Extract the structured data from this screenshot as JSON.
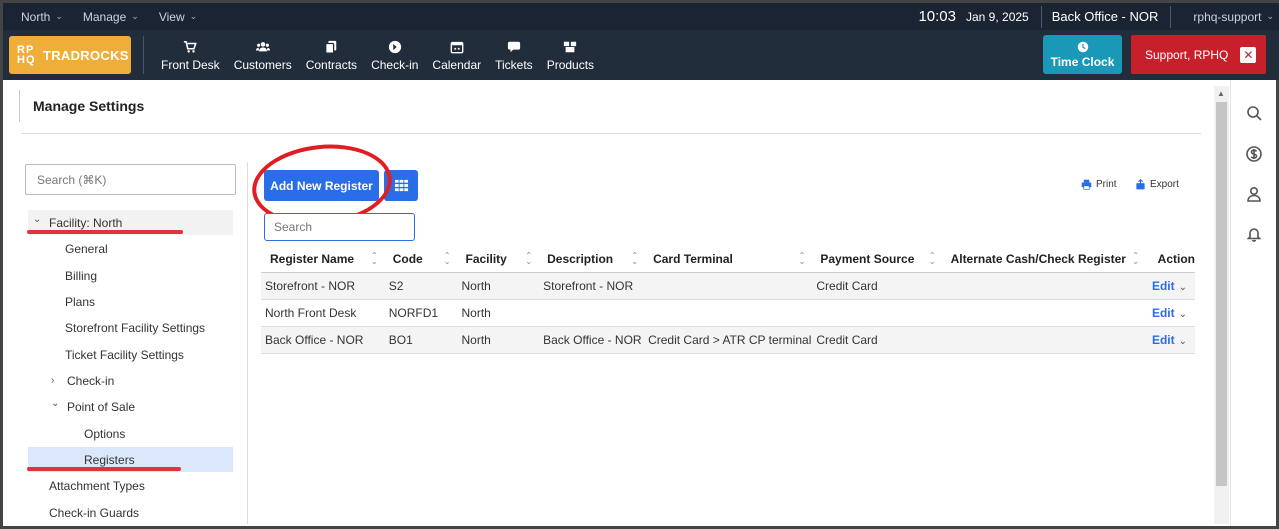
{
  "topbar": {
    "menus": [
      {
        "label": "North"
      },
      {
        "label": "Manage"
      },
      {
        "label": "View"
      }
    ],
    "time": "10:03",
    "date": "Jan 9, 2025",
    "register": "Back Office - NOR",
    "user": "rphq-support"
  },
  "nav": {
    "logo_mark_line1": "RP",
    "logo_mark_line2": "HQ",
    "logo_name": "TRADROCKS",
    "items": [
      {
        "label": "Front Desk",
        "icon": "cart-icon"
      },
      {
        "label": "Customers",
        "icon": "users-icon"
      },
      {
        "label": "Contracts",
        "icon": "contracts-icon"
      },
      {
        "label": "Check-in",
        "icon": "check-in-icon"
      },
      {
        "label": "Calendar",
        "icon": "calendar-icon"
      },
      {
        "label": "Tickets",
        "icon": "chat-icon"
      },
      {
        "label": "Products",
        "icon": "boxes-icon"
      }
    ],
    "time_clock": "Time Clock",
    "support": "Support, RPHQ"
  },
  "page": {
    "title": "Manage Settings"
  },
  "sidebar": {
    "search_placeholder": "Search (⌘K)",
    "items": [
      {
        "label": "Facility: North",
        "caret": "⌄",
        "level": 0
      },
      {
        "label": "General",
        "caret": "",
        "level": 1
      },
      {
        "label": "Billing",
        "caret": "",
        "level": 1
      },
      {
        "label": "Plans",
        "caret": "",
        "level": 1
      },
      {
        "label": "Storefront Facility Settings",
        "caret": "",
        "level": 1
      },
      {
        "label": "Ticket Facility Settings",
        "caret": "",
        "level": 1
      },
      {
        "label": "Check-in",
        "caret": "›",
        "level": 1
      },
      {
        "label": "Point of Sale",
        "caret": "⌄",
        "level": 1
      },
      {
        "label": "Options",
        "caret": "",
        "level": 2
      },
      {
        "label": "Registers",
        "caret": "",
        "level": 2,
        "selected": true
      },
      {
        "label": "Attachment Types",
        "caret": "",
        "level": 0
      },
      {
        "label": "Check-in Guards",
        "caret": "",
        "level": 0
      }
    ]
  },
  "main": {
    "add_button": "Add New Register",
    "search_placeholder": "Search",
    "print_label": "Print",
    "export_label": "Export",
    "columns": [
      "Register Name",
      "Code",
      "Facility",
      "Description",
      "Card Terminal",
      "Payment Source",
      "Alternate Cash/Check Register",
      "Action"
    ],
    "rows": [
      {
        "name": "Storefront - NOR",
        "code": "S2",
        "facility": "North",
        "description": "Storefront - NOR",
        "card_terminal": "",
        "payment_source": "Credit Card",
        "alternate": "",
        "action": "Edit"
      },
      {
        "name": "North Front Desk",
        "code": "NORFD1",
        "facility": "North",
        "description": "",
        "card_terminal": "",
        "payment_source": "",
        "alternate": "",
        "action": "Edit"
      },
      {
        "name": "Back Office - NOR",
        "code": "BO1",
        "facility": "North",
        "description": "Back Office - NOR",
        "card_terminal": "Credit Card > ATR CP terminal",
        "payment_source": "Credit Card",
        "alternate": "",
        "action": "Edit"
      }
    ]
  },
  "colors": {
    "accent": "#2a6de8",
    "annotation": "#e11d24",
    "logo": "#efae3a",
    "support": "#c8202b",
    "time_clock": "#1a98b8"
  }
}
